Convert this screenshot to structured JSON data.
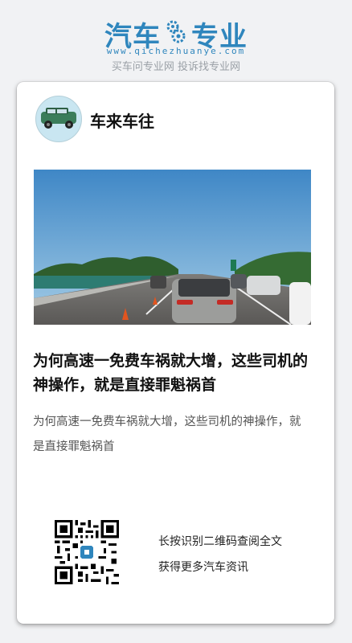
{
  "header": {
    "logo_left": "汽车",
    "logo_right": "专业",
    "url": "www.qichezhuanye.com",
    "slogan": "买车问专业网 投诉找专业网"
  },
  "account": {
    "name": "车来车往",
    "avatar_icon": "green-car-icon"
  },
  "article": {
    "title": "为何高速一免费车祸就大增，这些司机的神操作，就是直接罪魁祸首",
    "summary": "为何高速一免费车祸就大增，这些司机的神操作，就是直接罪魁祸首"
  },
  "footer": {
    "qr_line1": "长按识别二维码查阅全文",
    "qr_line2": "获得更多汽车资讯"
  }
}
